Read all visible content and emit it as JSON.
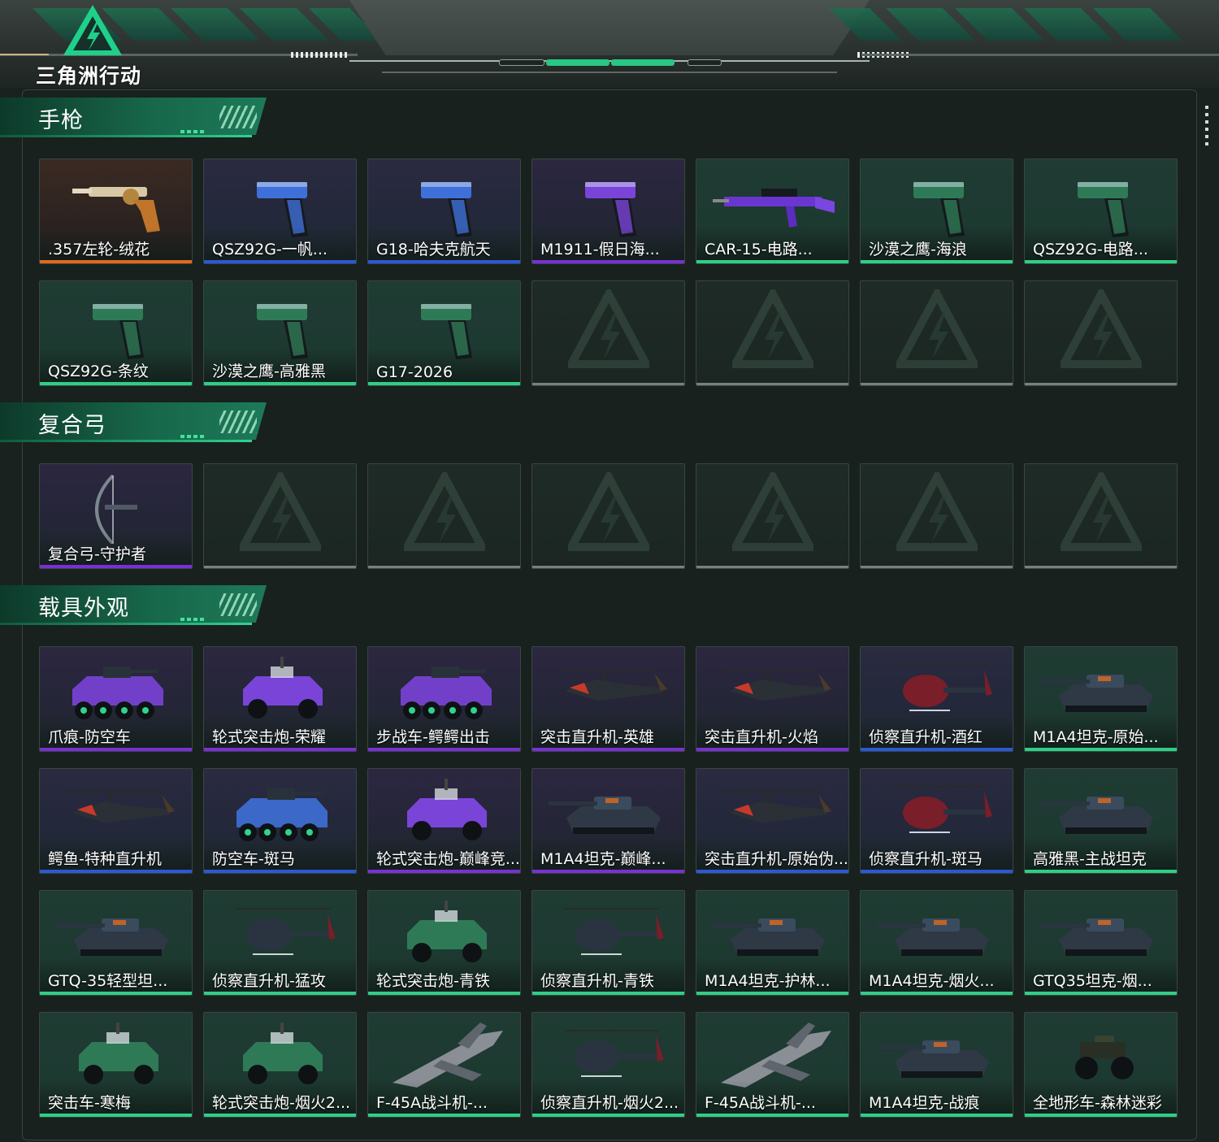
{
  "app": {
    "logo_text": "三角洲行动"
  },
  "colors": {
    "accent": "#27c786",
    "rarity_orange": "#e06a1a",
    "rarity_purple": "#7a2fd6",
    "rarity_blue": "#2a59d6",
    "rarity_green": "#2ecf86",
    "empty_bar": "#7c7f7d"
  },
  "sections": [
    {
      "title": "手枪",
      "items": [
        {
          "name": ".357左轮-绒花",
          "rarity": "orange",
          "icon": "revolver-icon"
        },
        {
          "name": "QSZ92G-一帆...",
          "rarity": "blue",
          "icon": "pistol-icon"
        },
        {
          "name": "G18-哈夫克航天",
          "rarity": "blue",
          "icon": "pistol-icon"
        },
        {
          "name": "M1911-假日海...",
          "rarity": "purple",
          "icon": "pistol-icon"
        },
        {
          "name": "CAR-15-电路...",
          "rarity": "green",
          "icon": "rifle-icon"
        },
        {
          "name": "沙漠之鹰-海浪",
          "rarity": "green",
          "icon": "pistol-icon"
        },
        {
          "name": "QSZ92G-电路...",
          "rarity": "green",
          "icon": "pistol-icon"
        },
        {
          "name": "QSZ92G-条纹",
          "rarity": "green",
          "icon": "pistol-icon"
        },
        {
          "name": "沙漠之鹰-高雅黑",
          "rarity": "green",
          "icon": "pistol-icon"
        },
        {
          "name": "G17-2026",
          "rarity": "green",
          "icon": "pistol-icon"
        },
        {
          "empty": true
        },
        {
          "empty": true
        },
        {
          "empty": true
        },
        {
          "empty": true
        }
      ]
    },
    {
      "title": "复合弓",
      "items": [
        {
          "name": "复合弓-守护者",
          "rarity": "purple",
          "icon": "bow-icon"
        },
        {
          "empty": true
        },
        {
          "empty": true
        },
        {
          "empty": true
        },
        {
          "empty": true
        },
        {
          "empty": true
        },
        {
          "empty": true
        }
      ]
    },
    {
      "title": "载具外观",
      "items": [
        {
          "name": "爪痕-防空车",
          "rarity": "purple",
          "icon": "apc-icon"
        },
        {
          "name": "轮式突击炮-荣耀",
          "rarity": "purple",
          "icon": "armored-car-icon"
        },
        {
          "name": "步战车-鳄鳄出击",
          "rarity": "purple",
          "icon": "apc-icon"
        },
        {
          "name": "突击直升机-英雄",
          "rarity": "purple",
          "icon": "attack-helicopter-icon"
        },
        {
          "name": "突击直升机-火焰",
          "rarity": "purple",
          "icon": "attack-helicopter-icon"
        },
        {
          "name": "侦察直升机-酒红",
          "rarity": "blue",
          "icon": "scout-helicopter-icon"
        },
        {
          "name": "M1A4坦克-原始...",
          "rarity": "green",
          "icon": "tank-icon"
        },
        {
          "name": "鳄鱼-特种直升机",
          "rarity": "blue",
          "icon": "attack-helicopter-icon"
        },
        {
          "name": "防空车-斑马",
          "rarity": "blue",
          "icon": "apc-icon"
        },
        {
          "name": "轮式突击炮-巅峰竞...",
          "rarity": "purple",
          "icon": "armored-car-icon"
        },
        {
          "name": "M1A4坦克-巅峰...",
          "rarity": "purple",
          "icon": "tank-icon"
        },
        {
          "name": "突击直升机-原始伪...",
          "rarity": "blue",
          "icon": "attack-helicopter-icon"
        },
        {
          "name": "侦察直升机-斑马",
          "rarity": "blue",
          "icon": "scout-helicopter-icon"
        },
        {
          "name": "高雅黑-主战坦克",
          "rarity": "green",
          "icon": "tank-icon"
        },
        {
          "name": "GTQ-35轻型坦...",
          "rarity": "green",
          "icon": "tank-icon"
        },
        {
          "name": "侦察直升机-猛攻",
          "rarity": "green",
          "icon": "scout-helicopter-icon"
        },
        {
          "name": "轮式突击炮-青铁",
          "rarity": "green",
          "icon": "armored-car-icon"
        },
        {
          "name": "侦察直升机-青铁",
          "rarity": "green",
          "icon": "scout-helicopter-icon"
        },
        {
          "name": "M1A4坦克-护林...",
          "rarity": "green",
          "icon": "tank-icon"
        },
        {
          "name": "M1A4坦克-烟火...",
          "rarity": "green",
          "icon": "tank-icon"
        },
        {
          "name": "GTQ35坦克-烟...",
          "rarity": "green",
          "icon": "tank-icon"
        },
        {
          "name": "突击车-寒梅",
          "rarity": "green",
          "icon": "armored-car-icon"
        },
        {
          "name": "轮式突击炮-烟火2...",
          "rarity": "green",
          "icon": "armored-car-icon"
        },
        {
          "name": "F-45A战斗机-...",
          "rarity": "green",
          "icon": "fighter-jet-icon"
        },
        {
          "name": "侦察直升机-烟火2...",
          "rarity": "green",
          "icon": "scout-helicopter-icon"
        },
        {
          "name": "F-45A战斗机-...",
          "rarity": "green",
          "icon": "fighter-jet-icon"
        },
        {
          "name": "M1A4坦克-战痕",
          "rarity": "green",
          "icon": "tank-icon"
        },
        {
          "name": "全地形车-森林迷彩",
          "rarity": "green",
          "icon": "atv-icon"
        }
      ]
    }
  ]
}
